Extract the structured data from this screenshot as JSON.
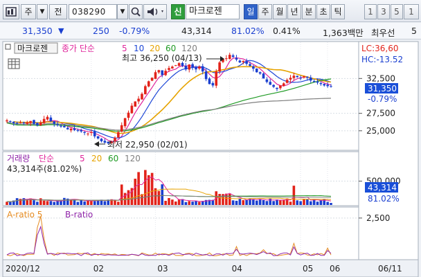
{
  "toolbar": {
    "market_label": "주",
    "prefix_label": "전",
    "stock_code": "038290",
    "new_badge": "신",
    "stock_name": "마크로젠",
    "periods": [
      "일",
      "주",
      "월",
      "년",
      "분",
      "초",
      "틱"
    ],
    "active_period": "일",
    "interval_buttons": [
      "1",
      "3",
      "5",
      "1"
    ]
  },
  "quote": {
    "price": "31,350",
    "down_arrow": "▼",
    "change": "250",
    "change_pct": "-0.79%",
    "volume": "43,314",
    "volume_ratio": "81.02%",
    "turnover": "0.41%",
    "amount": "1,363백만",
    "priority": "최우선",
    "scroll_right": "5"
  },
  "price_panel": {
    "legend_name": "마크로젠",
    "legend_ma_prefix": "종가 단순",
    "ma_periods": [
      "5",
      "10",
      "20",
      "60",
      "120"
    ],
    "ma_colors": [
      "#e0259b",
      "#1c46d6",
      "#e6a300",
      "#1f9a24",
      "#7f7f7f"
    ],
    "high_annot": "최고 36,250 (04/13)",
    "low_annot": "최저 22,950 (02/01)",
    "lc_label": "LC:36,60",
    "hc_label": "HC:-13.52",
    "current_price": "31,350",
    "current_pct": "-0.79%"
  },
  "volume_panel": {
    "legend_name": "거래량",
    "legend_ma_prefix": "단순",
    "ma_periods": [
      "5",
      "20",
      "60",
      "120"
    ],
    "ma_colors": [
      "#e0259b",
      "#e6a300",
      "#1f9a24",
      "#7f7f7f"
    ],
    "value_text": "43,314주(81.02%)",
    "current_volume": "43,314",
    "current_pct": "81.02%"
  },
  "ratio_panel": {
    "a_label": "A-ratio 5",
    "b_label": "B-ratio",
    "a_color": "#e58a1f",
    "b_color": "#8e23a8"
  },
  "x_axis": {
    "labels": [
      "2020/12",
      "02",
      "03",
      "04",
      "05",
      "06"
    ],
    "date_box": "06/11"
  },
  "chart_data": [
    {
      "type": "candlestick",
      "title": "마크로젠",
      "y_ticks": [
        25000,
        27500,
        32500
      ],
      "ylim": [
        22500,
        37200
      ],
      "x_ticks": [
        "2020/12",
        "02",
        "03",
        "04",
        "05",
        "06"
      ],
      "grid": true,
      "annotations": [
        {
          "text": "최고 36,250 (04/13)",
          "value": 36250
        },
        {
          "text": "최저 22,950 (02/01)",
          "value": 22950
        }
      ],
      "last_close": 31350,
      "close_approx": [
        26500,
        26300,
        26100,
        26000,
        26200,
        26100,
        26200,
        26400,
        26000,
        25800,
        26200,
        26700,
        27000,
        26400,
        26000,
        25800,
        25600,
        25500,
        25200,
        25300,
        25100,
        25000,
        24900,
        24700,
        24600,
        24800,
        24200,
        23900,
        23500,
        23300,
        23200,
        23400,
        24000,
        24800,
        25800,
        26800,
        27600,
        28600,
        29200,
        29600,
        30300,
        31400,
        32100,
        32600,
        33400,
        33700,
        33000,
        33600,
        34000,
        34200,
        34400,
        34700,
        34300,
        33800,
        34500,
        34100,
        33800,
        34200,
        33500,
        32400,
        31700,
        31500,
        33500,
        34800,
        35300,
        35400,
        35900,
        35600,
        35200,
        34800,
        35000,
        34600,
        34300,
        33900,
        33400,
        33200,
        32500,
        32000,
        31600,
        31300,
        31000,
        31500,
        31800,
        32300,
        32600,
        32900,
        32700,
        32500,
        32800,
        32600,
        32200,
        32000,
        31900,
        31700,
        31500,
        31400,
        31350
      ],
      "series": [
        {
          "name": "5",
          "color": "#e0259b"
        },
        {
          "name": "10",
          "color": "#1c46d6"
        },
        {
          "name": "20",
          "color": "#e6a300"
        },
        {
          "name": "60",
          "color": "#1f9a24"
        },
        {
          "name": "120",
          "color": "#7f7f7f"
        }
      ]
    },
    {
      "type": "bar",
      "title": "거래량",
      "y_ticks": [
        500000
      ],
      "last_value": 43314,
      "last_value_pct": "81.02%",
      "series": [
        {
          "name": "5",
          "color": "#e0259b"
        },
        {
          "name": "20",
          "color": "#e6a300"
        },
        {
          "name": "60",
          "color": "#1f9a24"
        },
        {
          "name": "120",
          "color": "#7f7f7f"
        }
      ]
    },
    {
      "type": "line",
      "title": "",
      "y_ticks": [
        2500
      ],
      "series": [
        {
          "name": "A-ratio 5",
          "color": "#e58a1f"
        },
        {
          "name": "B-ratio",
          "color": "#8e23a8"
        }
      ]
    }
  ]
}
